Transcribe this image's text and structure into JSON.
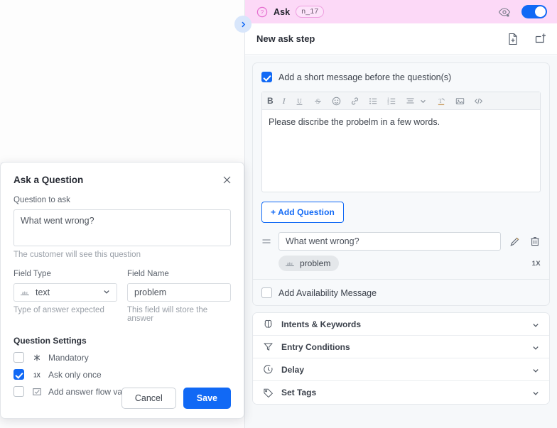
{
  "panel": {
    "header": {
      "icon": "question-circle-icon",
      "title": "Ask",
      "badge": "n_17",
      "preview_icon": "eye-preview-icon",
      "toggle_on": true
    },
    "subheader": {
      "title": "New ask step",
      "add_file_icon": "add-file-icon",
      "add_branch_icon": "add-step-icon"
    },
    "message_block": {
      "checkbox_label": "Add a short message before the question(s)",
      "checkbox_checked": true,
      "editor_text": "Please discribe the probelm in a few words.",
      "toolbar": [
        {
          "name": "bold-icon",
          "glyph": "B"
        },
        {
          "name": "italic-icon",
          "glyph": "I"
        },
        {
          "name": "underline-icon",
          "glyph": "U"
        },
        {
          "name": "strikethrough-icon",
          "glyph": "S"
        },
        {
          "name": "emoji-icon",
          "glyph": "emoji"
        },
        {
          "name": "link-icon",
          "glyph": "link"
        },
        {
          "name": "bulleted-list-icon",
          "glyph": "ul"
        },
        {
          "name": "numbered-list-icon",
          "glyph": "ol"
        },
        {
          "name": "align-icon",
          "glyph": "align"
        },
        {
          "name": "chevron-down-icon",
          "glyph": "chev"
        },
        {
          "name": "clear-formatting-icon",
          "glyph": "clear"
        },
        {
          "name": "insert-image-icon",
          "glyph": "image"
        },
        {
          "name": "code-view-icon",
          "glyph": "code"
        }
      ]
    },
    "add_question_label": "+ Add Question",
    "question_row": {
      "value": "What went wrong?",
      "tag_label": "problem",
      "tag_icon": "abc-text-icon",
      "count": "1X",
      "edit_icon": "pencil-edit-icon",
      "delete_icon": "trash-delete-icon",
      "drag_icon": "drag-handle-icon"
    },
    "availability": {
      "label": "Add Availability Message",
      "checked": false
    },
    "sections": [
      {
        "label": "Intents & Keywords",
        "icon": "brain-icon"
      },
      {
        "label": "Entry Conditions",
        "icon": "funnel-icon"
      },
      {
        "label": "Delay",
        "icon": "clock-icon"
      },
      {
        "label": "Set Tags",
        "icon": "tag-icon"
      }
    ]
  },
  "collapse_handle": {
    "icon": "chevron-right-icon"
  },
  "modal": {
    "title": "Ask a Question",
    "close_icon": "close-icon",
    "question": {
      "label": "Question to ask",
      "value": "What went wrong?",
      "hint": "The customer will see this question"
    },
    "field_type": {
      "label": "Field Type",
      "value": "text",
      "icon": "abc-text-icon",
      "hint": "Type of answer expected"
    },
    "field_name": {
      "label": "Field Name",
      "value": "problem",
      "hint": "This field will store the answer"
    },
    "settings": {
      "title": "Question Settings",
      "items": [
        {
          "label": "Mandatory",
          "checked": false,
          "icon": "asterisk-icon"
        },
        {
          "label": "Ask only once",
          "checked": true,
          "icon": "one-x-icon"
        },
        {
          "label": "Add answer flow validation",
          "checked": false,
          "icon": "checkbox-validate-icon"
        }
      ]
    },
    "buttons": {
      "cancel": "Cancel",
      "save": "Save"
    }
  },
  "colors": {
    "header_pink": "#fcd9f7",
    "accent_blue": "#1169f5",
    "panel_bg": "#f6f8fa"
  }
}
